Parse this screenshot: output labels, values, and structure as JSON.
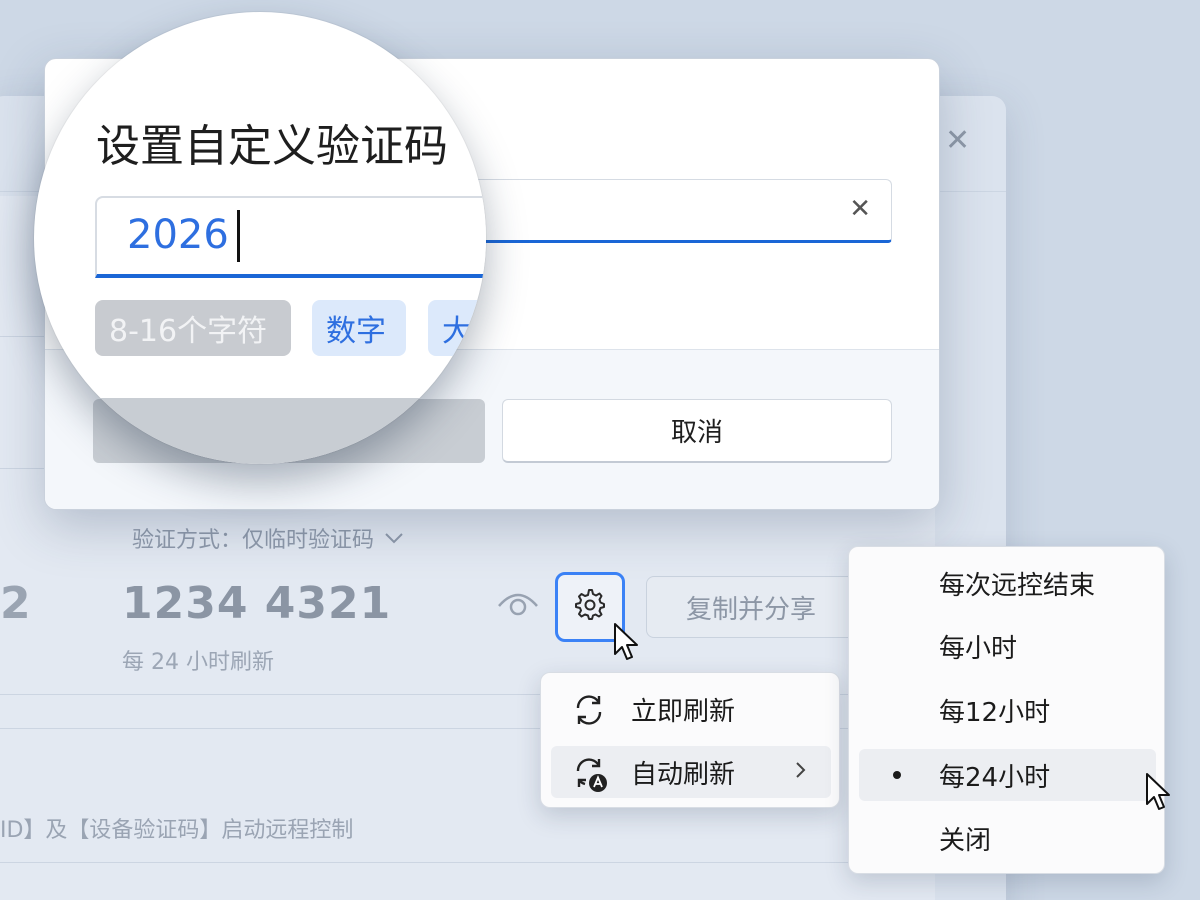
{
  "background": {
    "verify_method_label": "验证方式：仅临时验证码",
    "partial_digit": "2",
    "temp_code": "1234 4321",
    "refresh_note": "每 24 小时刷新",
    "share_button": "复制并分享",
    "footnote": "ID】及【设备验证码】启动远程控制"
  },
  "dialog": {
    "title": "设置自定义验证码",
    "input_value": "2026",
    "tags": [
      "8-16个字符",
      "数字",
      "大"
    ],
    "cancel_label": "取消"
  },
  "context_menu": {
    "items": [
      {
        "label": "立即刷新",
        "icon": "refresh-icon"
      },
      {
        "label": "自动刷新",
        "icon": "auto-refresh-icon",
        "has_submenu": true
      }
    ]
  },
  "auto_refresh_submenu": {
    "items": [
      "每次远控结束",
      "每小时",
      "每12小时",
      "每24小时",
      "关闭"
    ],
    "selected": "每24小时"
  },
  "colors": {
    "accent": "#1a66d6",
    "tag_blue_bg": "#dce9fb",
    "tag_blue_text": "#2e6fe0"
  }
}
